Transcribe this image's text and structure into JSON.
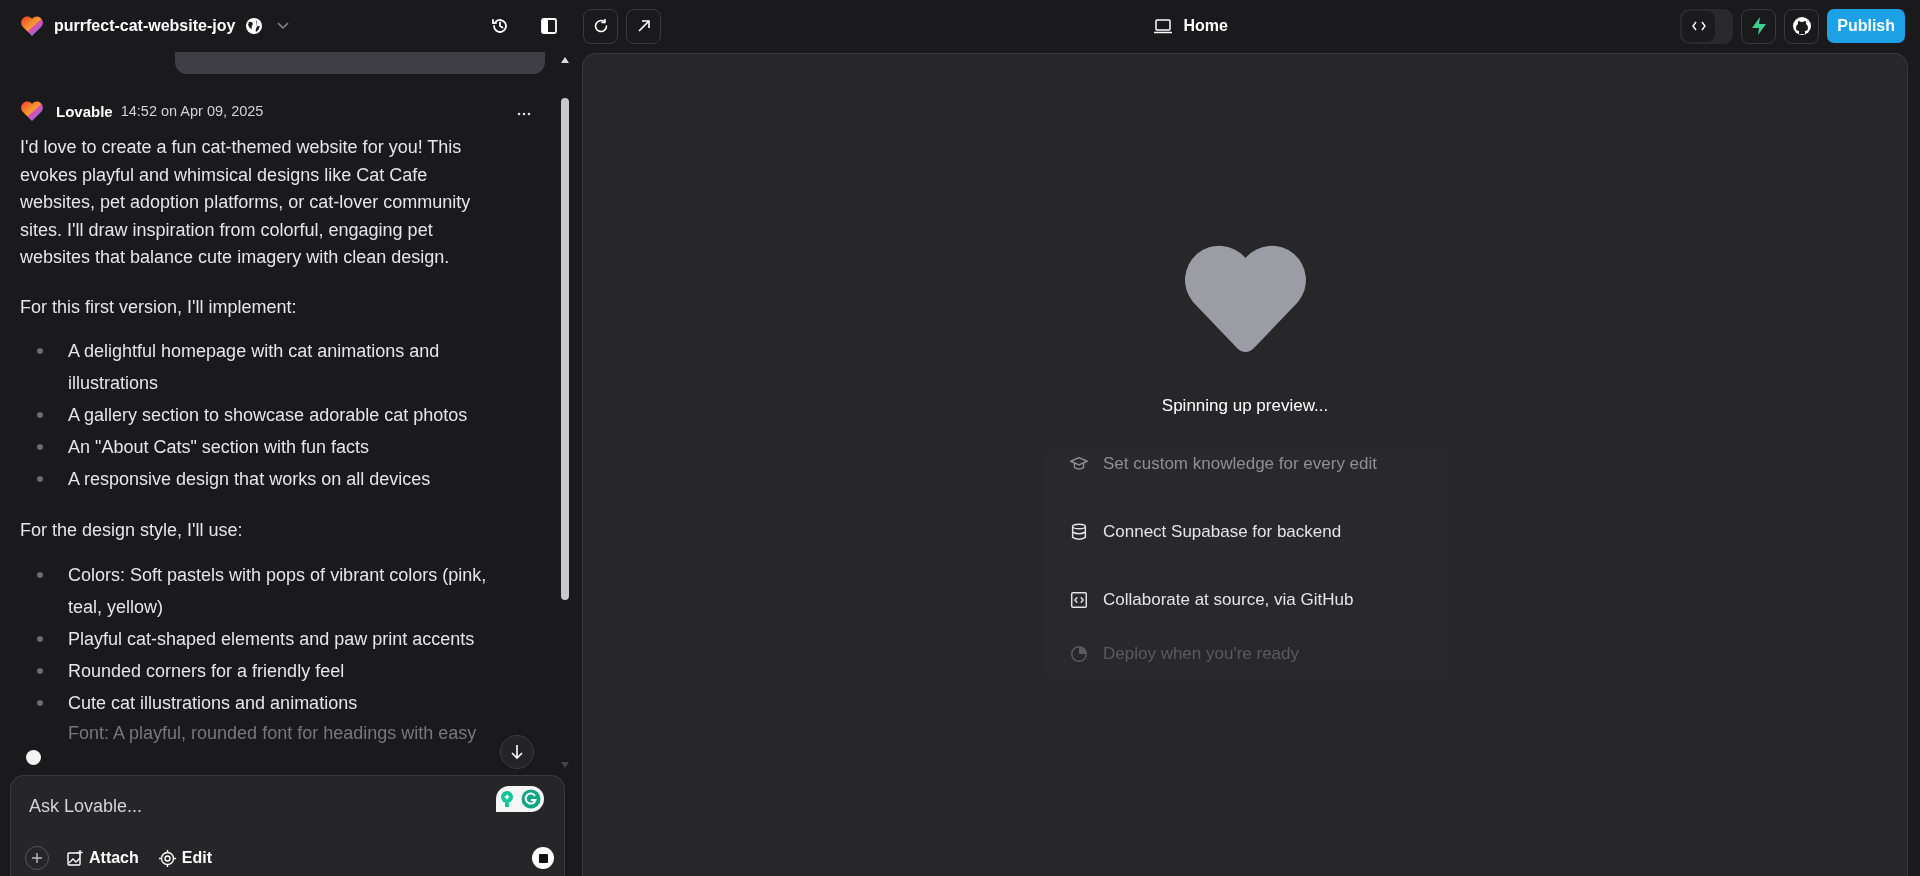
{
  "project": {
    "name": "purrfect-cat-website-joy"
  },
  "toolbar": {
    "preview_title": "Home",
    "code_view_on": false,
    "publish_button": "Publish"
  },
  "chat": {
    "message": {
      "author": "Lovable",
      "timestamp": "14:52 on Apr 09, 2025",
      "blocks": [
        {
          "kind": "paragraph",
          "text": "I'd love to create a fun cat-themed website for you! This evokes playful and whimsical designs like Cat Cafe websites, pet adoption platforms, or cat-lover community sites. I'll draw inspiration from colorful, engaging pet websites that balance cute imagery with clean design."
        },
        {
          "kind": "paragraph",
          "text": "For this first version, I'll implement:"
        },
        {
          "kind": "list",
          "items": [
            "A delightful homepage with cat animations and illustrations",
            "A gallery section to showcase adorable cat photos",
            "An \"About Cats\" section with fun facts",
            "A responsive design that works on all devices"
          ]
        },
        {
          "kind": "paragraph",
          "text": "For the design style, I'll use:"
        },
        {
          "kind": "list",
          "items": [
            "Colors: Soft pastels with pops of vibrant colors (pink, teal, yellow)",
            "Playful cat-shaped elements and paw print accents",
            "Rounded corners for a friendly feel",
            "Cute cat illustrations and animations"
          ]
        }
      ]
    },
    "faded_line": "Font: A playful, rounded font for headings with easy"
  },
  "composer": {
    "placeholder": "Ask Lovable...",
    "buttons": [
      "Attach",
      "Edit"
    ]
  },
  "preview": {
    "status": "Spinning up preview...",
    "tips": [
      "Set custom knowledge for every edit",
      "Connect Supabase for backend",
      "Collaborate at source, via GitHub",
      "Deploy when you're ready"
    ]
  }
}
